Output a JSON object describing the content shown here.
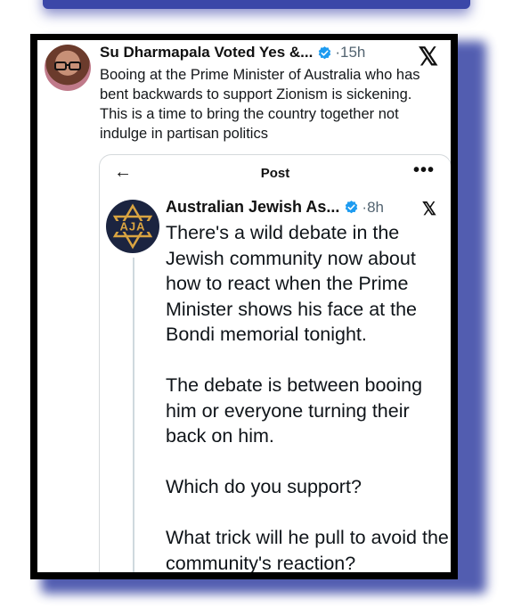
{
  "outer_post": {
    "author": "Su Dharmapala Voted Yes &...",
    "time": "·15h",
    "x_logo": "𝕏",
    "text": "Booing at the Prime Minister of Australia who has bent backwards to support Zionism is sickening. This is a time to bring the country together not indulge in partisan politics"
  },
  "quoted_post": {
    "nav_title": "Post",
    "back_icon": "←",
    "more_icon": "•••",
    "author": "Australian Jewish As...",
    "time": "·8h",
    "x_logo": "𝕏",
    "avatar_text": "AJA",
    "paragraphs": [
      "There's a wild debate in the Jewish community now about how to react when the Prime Minister shows his face at the Bondi memorial tonight.",
      "The debate is between booing him or everyone turning their back on him.",
      "Which do you support?",
      "What trick will he pull to avoid the community's reaction?"
    ]
  },
  "colors": {
    "frame": "#000000",
    "shadow": "#3441a3",
    "verified": "#1d9bf0",
    "aja_gold": "#d9a441",
    "aja_navy": "#1b2440"
  }
}
